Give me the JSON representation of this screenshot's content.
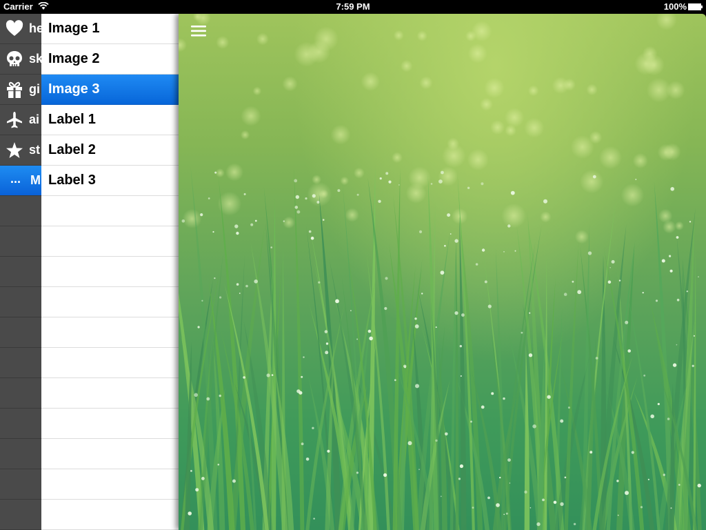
{
  "status_bar": {
    "carrier": "Carrier",
    "time": "7:59 PM",
    "battery": "100%"
  },
  "sidebar": {
    "items": [
      {
        "icon": "heart-icon",
        "label": "he"
      },
      {
        "icon": "skull-icon",
        "label": "sk"
      },
      {
        "icon": "gift-icon",
        "label": "gi"
      },
      {
        "icon": "airplane-icon",
        "label": "ai"
      },
      {
        "icon": "star-icon",
        "label": "st"
      },
      {
        "icon": "more-icon",
        "glyph": "...",
        "label": "M",
        "active": true
      }
    ]
  },
  "table": {
    "rows": [
      "Image 1",
      "Image 2",
      "Image 3",
      "Label 1",
      "Label 2",
      "Label 3"
    ],
    "selected_index": 2
  },
  "content": {
    "menu_icon": "hamburger-icon",
    "image": "green grass with dew drops"
  },
  "colors": {
    "accent": "#0a6fe0",
    "sidebar_bg": "#4a4a4a"
  }
}
